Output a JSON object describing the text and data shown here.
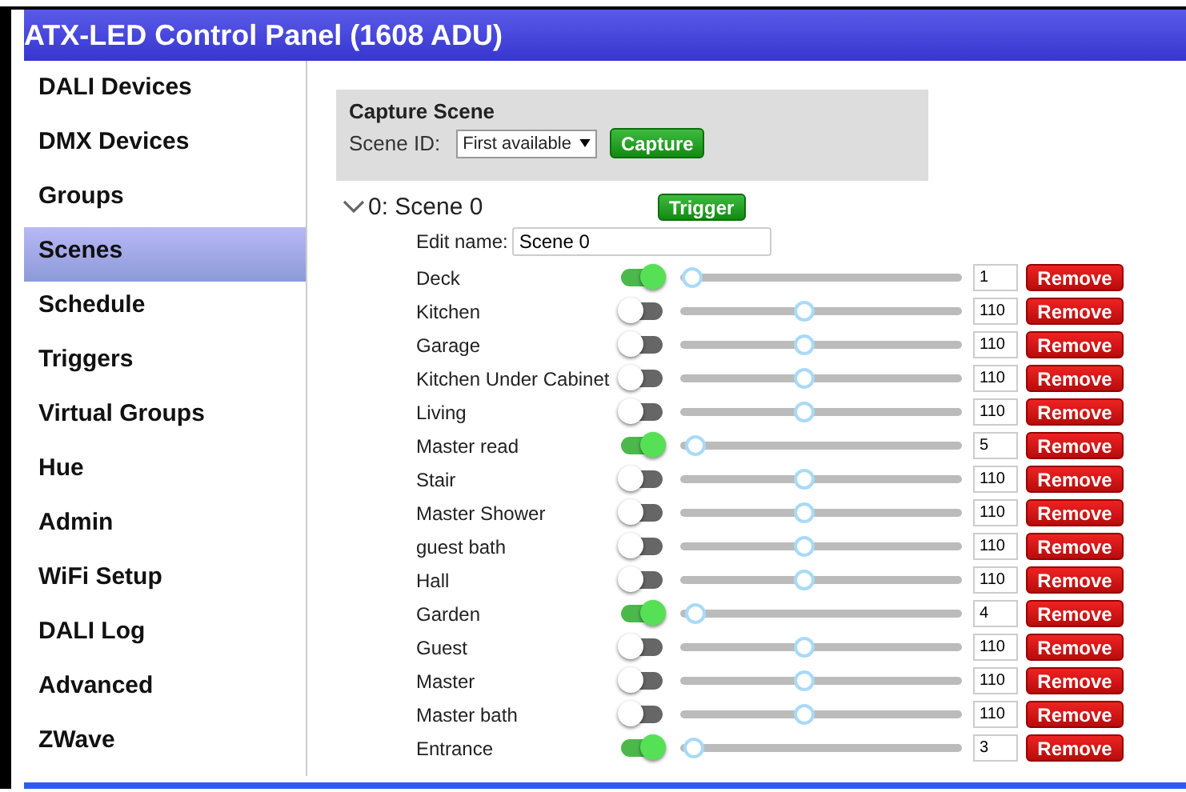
{
  "header": {
    "title": "ATX-LED Control Panel (1608 ADU)"
  },
  "sidebar": {
    "items": [
      {
        "label": "DALI Devices",
        "selected": false
      },
      {
        "label": "DMX Devices",
        "selected": false
      },
      {
        "label": "Groups",
        "selected": false
      },
      {
        "label": "Scenes",
        "selected": true
      },
      {
        "label": "Schedule",
        "selected": false
      },
      {
        "label": "Triggers",
        "selected": false
      },
      {
        "label": "Virtual Groups",
        "selected": false
      },
      {
        "label": "Hue",
        "selected": false
      },
      {
        "label": "Admin",
        "selected": false
      },
      {
        "label": "WiFi Setup",
        "selected": false
      },
      {
        "label": "DALI Log",
        "selected": false
      },
      {
        "label": "Advanced",
        "selected": false
      },
      {
        "label": "ZWave",
        "selected": false
      }
    ]
  },
  "capture": {
    "title": "Capture Scene",
    "scene_id_label": "Scene ID:",
    "scene_id_value": "First available",
    "button": "Capture"
  },
  "scene": {
    "title": "0: Scene 0",
    "expanded": true,
    "trigger_button": "Trigger",
    "edit_name_label": "Edit name:",
    "edit_name_value": "Scene 0",
    "channels": [
      {
        "name": "Deck",
        "on": true,
        "level": 0.004,
        "value": "1",
        "button": "Remove"
      },
      {
        "name": "Kitchen",
        "on": false,
        "level": 0.433,
        "value": "110",
        "button": "Remove"
      },
      {
        "name": "Garage",
        "on": false,
        "level": 0.433,
        "value": "110",
        "button": "Remove"
      },
      {
        "name": "Kitchen Under Cabinet",
        "on": false,
        "level": 0.433,
        "value": "110",
        "button": "Remove"
      },
      {
        "name": "Living",
        "on": false,
        "level": 0.433,
        "value": "110",
        "button": "Remove"
      },
      {
        "name": "Master read",
        "on": true,
        "level": 0.02,
        "value": "5",
        "button": "Remove"
      },
      {
        "name": "Stair",
        "on": false,
        "level": 0.433,
        "value": "110",
        "button": "Remove"
      },
      {
        "name": "Master Shower",
        "on": false,
        "level": 0.433,
        "value": "110",
        "button": "Remove"
      },
      {
        "name": "guest bath",
        "on": false,
        "level": 0.433,
        "value": "110",
        "button": "Remove"
      },
      {
        "name": "Hall",
        "on": false,
        "level": 0.433,
        "value": "110",
        "button": "Remove"
      },
      {
        "name": "Garden",
        "on": true,
        "level": 0.016,
        "value": "4",
        "button": "Remove"
      },
      {
        "name": "Guest",
        "on": false,
        "level": 0.433,
        "value": "110",
        "button": "Remove"
      },
      {
        "name": "Master",
        "on": false,
        "level": 0.433,
        "value": "110",
        "button": "Remove"
      },
      {
        "name": "Master bath",
        "on": false,
        "level": 0.433,
        "value": "110",
        "button": "Remove"
      },
      {
        "name": "Entrance",
        "on": true,
        "level": 0.012,
        "value": "3",
        "button": "Remove"
      }
    ]
  }
}
